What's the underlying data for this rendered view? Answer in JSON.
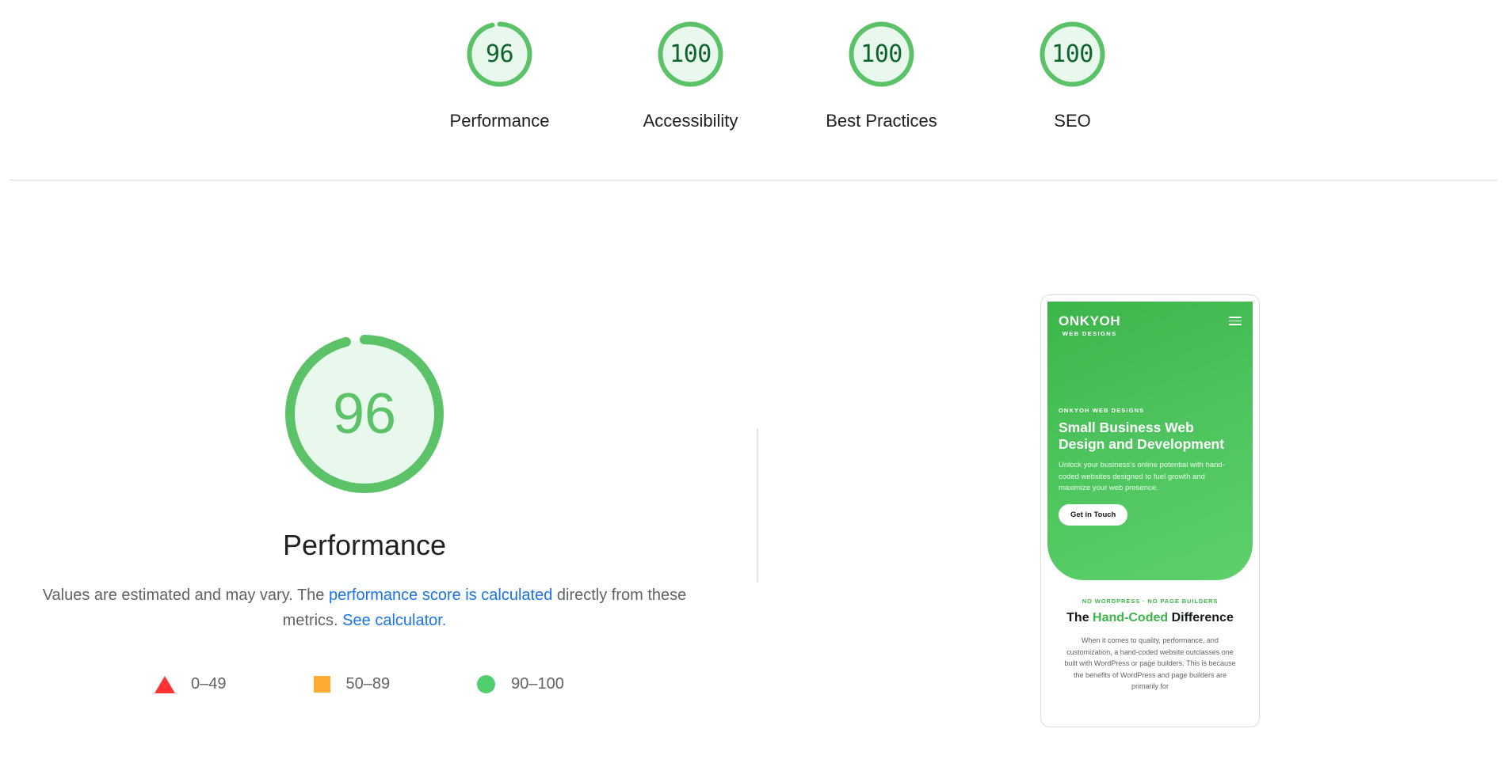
{
  "summary": {
    "gauges": [
      {
        "value": "96",
        "score": 96,
        "label": "Performance",
        "icon": "circular-gauge-icon",
        "color": "#5cc268"
      },
      {
        "value": "100",
        "score": 100,
        "label": "Accessibility",
        "icon": "circular-gauge-icon",
        "color": "#5cc268"
      },
      {
        "value": "100",
        "score": 100,
        "label": "Best Practices",
        "icon": "circular-gauge-icon",
        "color": "#5cc268"
      },
      {
        "value": "100",
        "score": 100,
        "label": "SEO",
        "icon": "circular-gauge-icon",
        "color": "#5cc268"
      }
    ]
  },
  "score_panel": {
    "value": "96",
    "score": 96,
    "title": "Performance",
    "description_prefix": "Values are estimated and may vary. The ",
    "link_calculated": "performance score is calculated",
    "description_middle": " directly from these metrics. ",
    "link_see_calculator": "See calculator.",
    "link_color": "#1a73e8",
    "gauge_color": "#5cc268",
    "gauge_fill": "#e8f8ed"
  },
  "legend": {
    "items": [
      {
        "shape": "triangle-icon",
        "color": "#ff3333",
        "label": "0–49"
      },
      {
        "shape": "square-icon",
        "color": "#ffaa33",
        "label": "50–89"
      },
      {
        "shape": "circle-icon",
        "color": "#4fcf6e",
        "label": "90–100"
      }
    ]
  },
  "preview": {
    "hero": {
      "brand_main": "ONKYOH",
      "brand_sub": "WEB DESIGNS",
      "menu_icon": "hamburger-menu-icon",
      "eyebrow": "ONKYOH WEB DESIGNS",
      "title": "Small Business Web Design and Development",
      "body": "Unlock your business's online potential with hand-coded websites designed to fuel growth and maximize your web presence.",
      "cta_label": "Get in Touch"
    },
    "section2": {
      "eyebrow": "NO WORDPRESS · NO PAGE BUILDERS",
      "title_part1": "The ",
      "title_highlight": "Hand-Coded",
      "title_part2": " Difference",
      "body": "When it comes to quality, performance, and customization, a hand-coded website outclasses one built with WordPress or page builders. This is because the benefits of WordPress and page builders are primarily for"
    }
  }
}
